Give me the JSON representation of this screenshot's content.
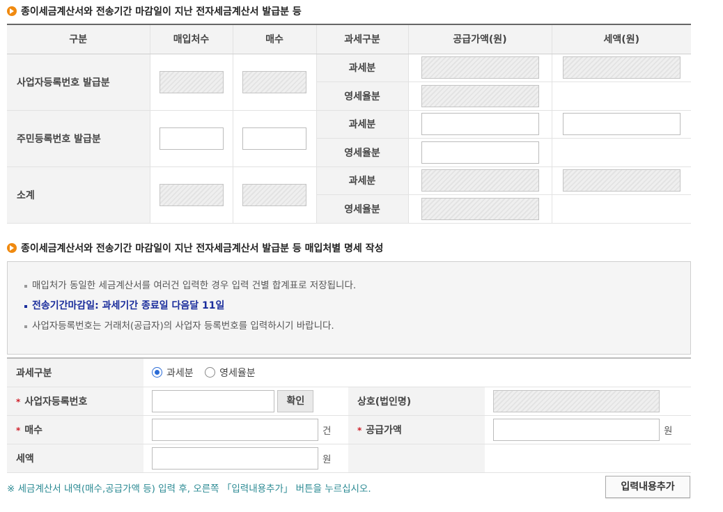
{
  "section1": {
    "title": "종이세금계산서와 전송기간 마감일이 지난 전자세금계산서 발급분 등",
    "headers": [
      "구분",
      "매입처수",
      "매수",
      "과세구분",
      "공급가액(원)",
      "세액(원)"
    ],
    "groups": [
      {
        "label": "사업자등록번호 발급분"
      },
      {
        "label": "주민등록번호 발급분"
      },
      {
        "label": "소계"
      }
    ],
    "sub_taxable": "과세분",
    "sub_zero": "영세율분"
  },
  "section2": {
    "title": "종이세금계산서와 전송기간 마감일이 지난 전자세금계산서 발급분 등 매입처별 명세 작성",
    "info": [
      "매입처가 동일한 세금계산서를 여러건 입력한 경우 입력 건별 합계표로 저장됩니다.",
      "전송기간마감일: 과세기간 종료일 다음달 11일",
      "사업자등록번호는 거래처(공급자)의 사업자 등록번호를 입력하시기 바랍니다."
    ]
  },
  "form": {
    "tax_type_label": "과세구분",
    "radio_taxable": "과세분",
    "radio_zero": "영세율분",
    "selected": "과세분",
    "bizno_label": "사업자등록번호",
    "confirm_button": "확인",
    "company_label": "상호(법인명)",
    "count_label": "매수",
    "count_unit": "건",
    "supply_label": "공급가액",
    "supply_unit": "원",
    "tax_label": "세액",
    "tax_unit": "원",
    "required_mark": "*"
  },
  "note": "※ 세금계산서 내역(매수,공급가액 등) 입력 후, 오른쪽 「입력내용추가」 버튼을 누르십시오.",
  "add_button": "입력내용추가"
}
